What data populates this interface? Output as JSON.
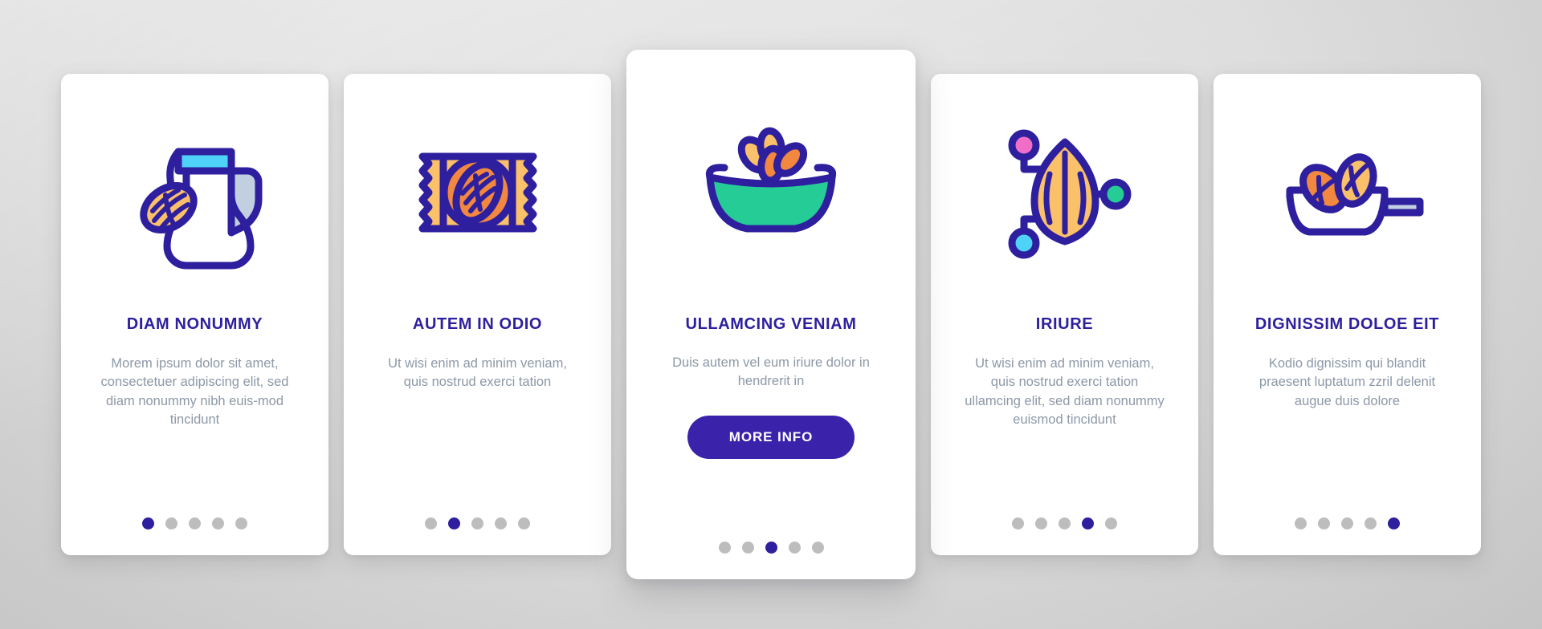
{
  "palette": {
    "navy": "#2d1f9e",
    "button_purple": "#3a22ab",
    "orange_light": "#fbc06a",
    "orange_deep": "#f2883f",
    "cyan": "#4fd2f7",
    "teal_green": "#25cc96",
    "pink": "#f06ec8",
    "blue_grey": "#c2cfe0",
    "dot_inactive": "#bdbdbd",
    "body_text": "#8d98a7",
    "card_bg": "#ffffff",
    "page_bg": "#dedede"
  },
  "total_slides": 5,
  "cards": [
    {
      "icon": "almond-milk-jug-icon",
      "title": "DIAM NONUMMY",
      "body": "Morem ipsum dolor sit amet, consectetuer adipiscing elit, sed diam nonummy nibh euis-mod tincidunt",
      "button": null,
      "active_dot": 1,
      "featured": false
    },
    {
      "icon": "almond-candy-wrapper-icon",
      "title": "AUTEM IN ODIO",
      "body": "Ut wisi enim ad minim veniam, quis nostrud exerci tation",
      "button": null,
      "active_dot": 2,
      "featured": false
    },
    {
      "icon": "almond-bowl-icon",
      "title": "ULLAMCING VENIAM",
      "body": "Duis autem vel eum iriure dolor in hendrerit in",
      "button": "MORE INFO",
      "active_dot": 3,
      "featured": true
    },
    {
      "icon": "almond-network-nodes-icon",
      "title": "IRIURE",
      "body": "Ut wisi enim ad minim veniam, quis nostrud exerci tation ullamcing elit, sed diam nonummy euismod tincidunt",
      "button": null,
      "active_dot": 4,
      "featured": false
    },
    {
      "icon": "almond-frying-pan-icon",
      "title": "DIGNISSIM DOLOE EIT",
      "body": "Kodio dignissim qui blandit praesent luptatum zzril delenit augue duis dolore",
      "button": null,
      "active_dot": 5,
      "featured": false
    }
  ]
}
